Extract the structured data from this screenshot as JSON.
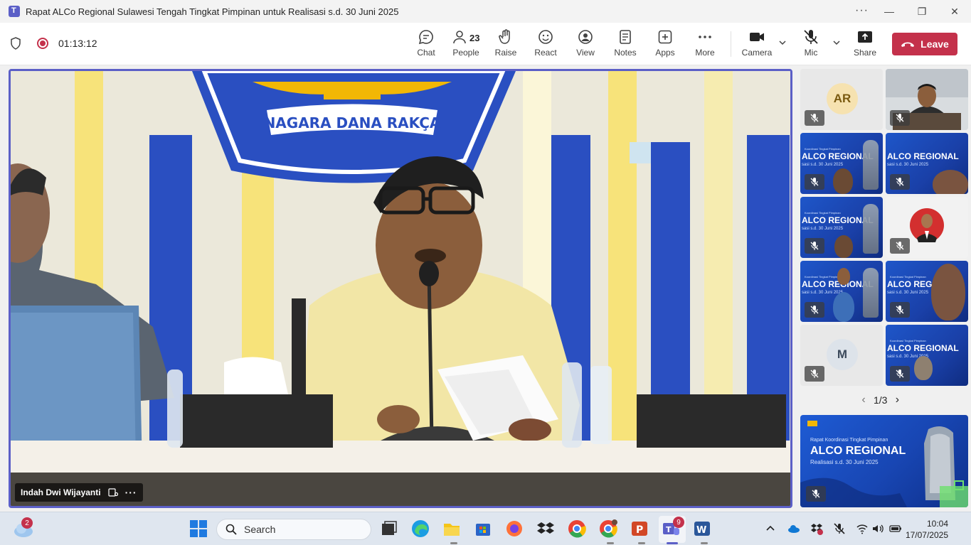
{
  "window": {
    "title": "Rapat ALCo Regional Sulawesi Tengah Tingkat Pimpinan untuk Realisasi s.d. 30 Juni 2025",
    "more": "···",
    "minimize": "—",
    "restore": "❐",
    "close": "✕"
  },
  "meeting": {
    "timer": "01:13:12",
    "people_count": "23",
    "toolbar": [
      {
        "label": "Chat",
        "icon": "chat-icon"
      },
      {
        "label": "People",
        "icon": "people-icon"
      },
      {
        "label": "Raise",
        "icon": "raise-hand-icon"
      },
      {
        "label": "React",
        "icon": "react-icon"
      },
      {
        "label": "View",
        "icon": "view-icon"
      },
      {
        "label": "Notes",
        "icon": "notes-icon"
      },
      {
        "label": "Apps",
        "icon": "apps-icon"
      },
      {
        "label": "More",
        "icon": "more-icon"
      },
      {
        "label": "Camera",
        "icon": "camera-icon"
      },
      {
        "label": "Mic",
        "icon": "mic-off-icon"
      },
      {
        "label": "Share",
        "icon": "share-icon"
      }
    ],
    "leave_label": "Leave"
  },
  "stage": {
    "speaker_name": "Indah Dwi Wijayanti",
    "banner_text": "NAGARA DANA RAKÇA"
  },
  "gallery": {
    "tiles": [
      {
        "type": "initials",
        "initials": "AR",
        "muted": true
      },
      {
        "type": "video",
        "muted": true
      },
      {
        "type": "promo",
        "title": "ALCO REGIONAL",
        "sub": "sasi s.d. 30 Juni 2025",
        "kicker": "Koordinasi Tingkat Pimpinan",
        "muted": true
      },
      {
        "type": "promo",
        "title": "ALCO REGIONAL",
        "sub": "sasi s.d. 30 Juni 2025",
        "muted": true
      },
      {
        "type": "promo",
        "title": "ALCO REGIONAL",
        "sub": "sasi s.d. 30 Juni 2025",
        "kicker": "Koordinasi Tingkat Pimpinan",
        "muted": true
      },
      {
        "type": "photo",
        "muted": true
      },
      {
        "type": "promo",
        "title": "ALCO REGIONAL",
        "sub": "sasi s.d. 30 Juni 2025",
        "kicker": "Koordinasi Tingkat Pimpinan",
        "muted": true
      },
      {
        "type": "promo",
        "title": "ALCO REGIONA",
        "sub": "sasi s.d. 30 Juni 2025",
        "kicker": "Koordinasi Tingkat Pimpinan",
        "muted": true
      },
      {
        "type": "initials",
        "initials": "M",
        "muted": true
      },
      {
        "type": "promo",
        "title": "ALCO REGIONAL",
        "sub": "sasi s.d. 30 Juni 2025",
        "kicker": "Koordinasi Tingkat Pimpinan",
        "muted": true
      }
    ],
    "pager": "1/3",
    "prev": "‹",
    "next": "›"
  },
  "pip": {
    "kicker": "Rapat Koordinasi Tingkat Pimpinan",
    "title": "ALCO REGIONAL",
    "sub": "Realisasi s.d. 30 Juni 2025"
  },
  "taskbar": {
    "weather_badge": "2",
    "search_placeholder": "Search",
    "teams_badge": "9",
    "time": "10:04",
    "date": "17/07/2025"
  },
  "colors": {
    "accent": "#5b5fc7",
    "leave": "#c4314b",
    "stage_border": "#5b5fc7"
  }
}
